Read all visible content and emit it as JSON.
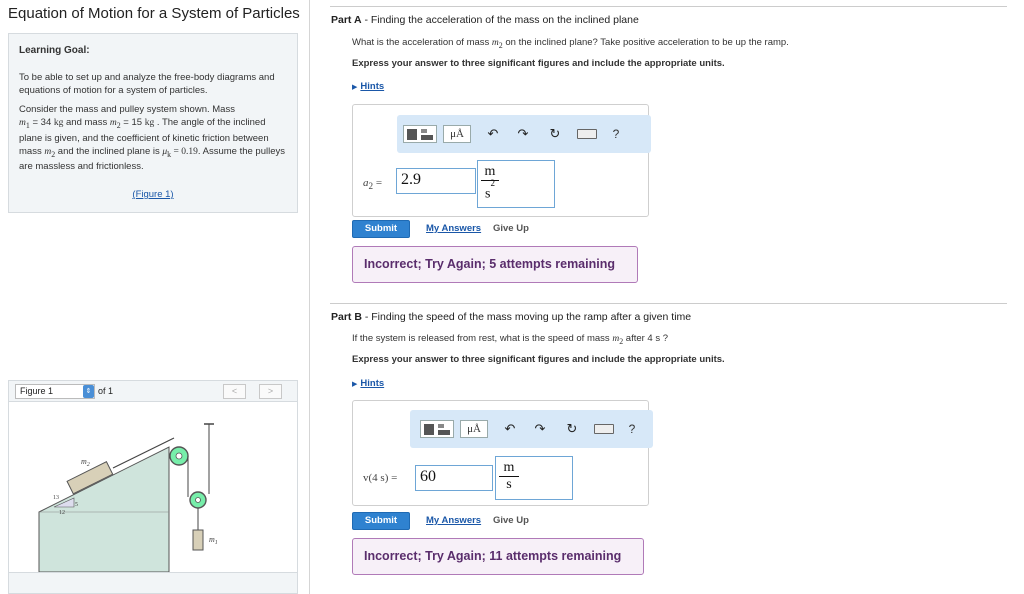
{
  "page": {
    "title": "Equation of Motion for a System of Particles"
  },
  "goal": {
    "title": "Learning Goal:",
    "text": "To be able to set up and analyze the free-body diagrams and equations of motion for a system of particles.",
    "problem": {
      "p1": "Consider the mass and pulley system shown. Mass",
      "m1_var": "m",
      "m1_sub": "1",
      "m1_eq": " = 34 ",
      "m1_unit": "kg",
      "p2": " and mass ",
      "m2_var": "m",
      "m2_sub": "2",
      "m2_eq": " = 15 ",
      "m2_unit": "kg",
      "p3": " . The angle of the inclined plane is given, and the coefficient of kinetic friction between mass ",
      "m2b_var": "m",
      "m2b_sub": "2",
      "p4": " and the inclined plane is ",
      "mu_var": "μ",
      "mu_sub": "k",
      "mu_eq": " = 0.19",
      "p5": ". Assume the pulleys are massless and frictionless."
    },
    "figure_link": "(Figure 1)"
  },
  "figure": {
    "select_value": "Figure 1",
    "of_text": "of 1",
    "prev_icon": "chevron-left-icon",
    "next_icon": "chevron-right-icon",
    "label_m2": "m",
    "label_m2_sub": "2",
    "label_m1": "m",
    "label_m1_sub": "1",
    "tri_13": "13",
    "tri_5": "5",
    "tri_12": "12"
  },
  "partA": {
    "label": "Part A",
    "title": " - Finding the acceleration of the mass on the inclined plane",
    "question_pre": "What is the acceleration of mass ",
    "q_var": "m",
    "q_sub": "2",
    "question_post": " on the inclined plane? Take positive acceleration to be up the ramp.",
    "instruction": "Express your answer to three significant figures and include the appropriate units.",
    "hints": "Hints",
    "var_name": "a",
    "var_sub": "2",
    "var_eq": " = ",
    "value": "2.9",
    "unit_num": "m",
    "unit_den": "s",
    "unit_den_exp": "2",
    "submit": "Submit",
    "my_answers": "My Answers",
    "give_up": "Give Up",
    "feedback": "Incorrect; Try Again; 5 attempts remaining"
  },
  "partB": {
    "label": "Part B",
    "title": " - Finding the speed of the mass moving up the ramp after a given time",
    "question_pre": "If the system is released from rest, what is the speed of mass ",
    "q_var": "m",
    "q_sub": "2",
    "question_post": " after 4  s ?",
    "instruction": "Express your answer to three significant figures and include the appropriate units.",
    "hints": "Hints",
    "var_label": "v(4 s) = ",
    "value": "60",
    "unit_num": "m",
    "unit_den": "s",
    "submit": "Submit",
    "my_answers": "My Answers",
    "give_up": "Give Up",
    "feedback": "Incorrect; Try Again; 11 attempts remaining"
  },
  "toolbar": {
    "template_icon": "template-icon",
    "mu_label": "μÅ",
    "undo_icon": "undo-arrow-icon",
    "redo_icon": "redo-arrow-icon",
    "reset_icon": "reset-icon",
    "keyboard_icon": "keyboard-icon",
    "help_label": "?"
  }
}
